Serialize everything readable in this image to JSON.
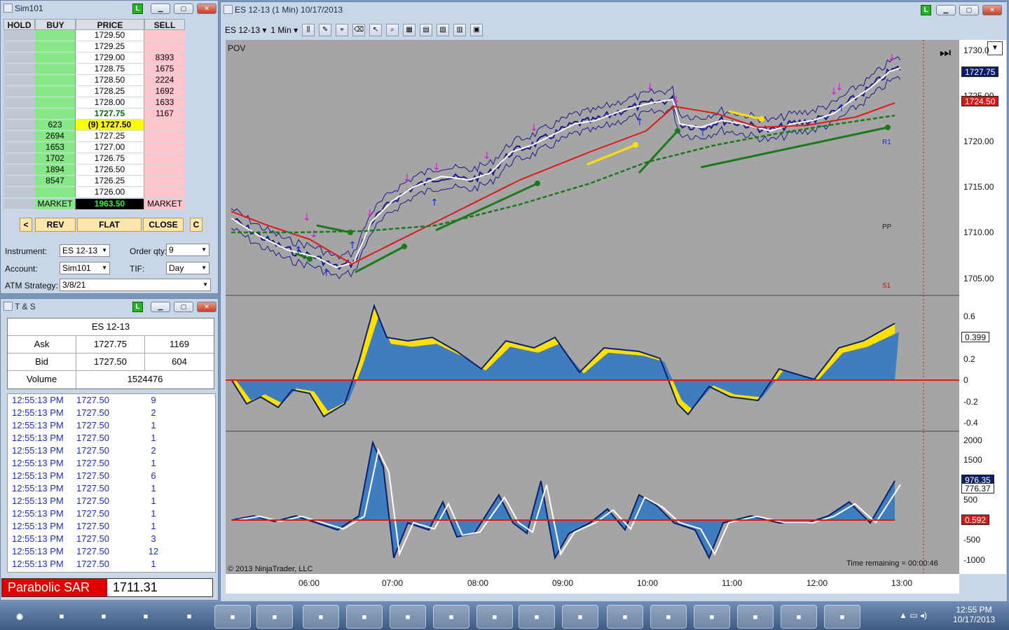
{
  "dom_window": {
    "title": "Sim101"
  },
  "dom": {
    "headers": [
      "HOLD",
      "BUY",
      "PRICE",
      "SELL"
    ],
    "rows": [
      {
        "buy": "",
        "price": "1729.50",
        "sell": ""
      },
      {
        "buy": "",
        "price": "1729.25",
        "sell": ""
      },
      {
        "buy": "",
        "price": "1729.00",
        "sell": "8393"
      },
      {
        "buy": "",
        "price": "1728.75",
        "sell": "1675"
      },
      {
        "buy": "",
        "price": "1728.50",
        "sell": "2224"
      },
      {
        "buy": "",
        "price": "1728.25",
        "sell": "1692"
      },
      {
        "buy": "",
        "price": "1728.00",
        "sell": "1633"
      },
      {
        "buy": "",
        "price": "1727.75",
        "sell": "1167"
      },
      {
        "buy": "623",
        "price": "(9) 1727.50",
        "sell": ""
      },
      {
        "buy": "2694",
        "price": "1727.25",
        "sell": ""
      },
      {
        "buy": "1653",
        "price": "1727.00",
        "sell": ""
      },
      {
        "buy": "1702",
        "price": "1726.75",
        "sell": ""
      },
      {
        "buy": "1894",
        "price": "1726.50",
        "sell": ""
      },
      {
        "buy": "8547",
        "price": "1726.25",
        "sell": ""
      },
      {
        "buy": "",
        "price": "1726.00",
        "sell": ""
      }
    ],
    "market_buy": "MARKET",
    "pnl": "1963.50",
    "market_sell": "MARKET"
  },
  "actions": {
    "left": "<",
    "rev": "REV",
    "flat": "FLAT",
    "close": "CLOSE",
    "c": "C"
  },
  "order": {
    "instrument_label": "Instrument:",
    "instrument": "ES 12-13",
    "qty_label": "Order qty:",
    "qty": "9",
    "account_label": "Account:",
    "account": "Sim101",
    "tif_label": "TIF:",
    "tif": "Day",
    "atm_label": "ATM Strategy:",
    "atm": "3/8/21"
  },
  "ts_window": {
    "title": "T & S",
    "instrument": "ES 12-13",
    "ask_label": "Ask",
    "ask": "1727.75",
    "ask_size": "1169",
    "bid_label": "Bid",
    "bid": "1727.50",
    "bid_size": "604",
    "volume_label": "Volume",
    "volume": "1524476",
    "trades": [
      {
        "t": "12:55:13 PM",
        "p": "1727.50",
        "q": "9"
      },
      {
        "t": "12:55:13 PM",
        "p": "1727.50",
        "q": "2"
      },
      {
        "t": "12:55:13 PM",
        "p": "1727.50",
        "q": "1"
      },
      {
        "t": "12:55:13 PM",
        "p": "1727.50",
        "q": "1"
      },
      {
        "t": "12:55:13 PM",
        "p": "1727.50",
        "q": "2"
      },
      {
        "t": "12:55:13 PM",
        "p": "1727.50",
        "q": "1"
      },
      {
        "t": "12:55:13 PM",
        "p": "1727.50",
        "q": "6"
      },
      {
        "t": "12:55:13 PM",
        "p": "1727.50",
        "q": "1"
      },
      {
        "t": "12:55:13 PM",
        "p": "1727.50",
        "q": "1"
      },
      {
        "t": "12:55:13 PM",
        "p": "1727.50",
        "q": "1"
      },
      {
        "t": "12:55:13 PM",
        "p": "1727.50",
        "q": "1"
      },
      {
        "t": "12:55:13 PM",
        "p": "1727.50",
        "q": "3"
      },
      {
        "t": "12:55:13 PM",
        "p": "1727.50",
        "q": "12"
      },
      {
        "t": "12:55:13 PM",
        "p": "1727.50",
        "q": "1"
      }
    ],
    "sar_label": "Parabolic SAR",
    "sar_value": "1711.31"
  },
  "chart_window": {
    "title": "ES 12-13 (1 Min)  10/17/2013",
    "instrument": "ES 12-13",
    "interval": "1 Min",
    "pov": "POV",
    "copyright": "© 2013 NinjaTrader, LLC",
    "time_remaining": "Time remaining = 00:00:46",
    "r1": "R1",
    "pp": "PP",
    "s1": "S1",
    "price_ticks": [
      "1730.0",
      "1725.00",
      "1720.00",
      "1715.00",
      "1710.00",
      "1705.00"
    ],
    "last_price": "1727.75",
    "ma_price": "1724.50",
    "osc1_ticks": [
      "0.6",
      "0.4",
      "0.2",
      "0",
      "-0.2",
      "-0.4"
    ],
    "osc1_value": "0.399",
    "osc2_ticks": [
      "2000",
      "1500",
      "1000",
      "500",
      "0",
      "-500",
      "-1000"
    ],
    "osc2_value_a": "976.35",
    "osc2_value_b": "776.37",
    "osc2_value_c": "0.592",
    "time_ticks": [
      "06:00",
      "07:00",
      "08:00",
      "09:00",
      "10:00",
      "11:00",
      "12:00",
      "13:00"
    ],
    "colors": {
      "price_line": "#1a1a8c",
      "ma_red": "#e01818",
      "ma_green": "#1a7a1a",
      "osc_fill": "#3f7dbf",
      "osc_yellow": "#ffe000",
      "zero": "#e01818"
    }
  },
  "taskbar": {
    "time": "12:55 PM",
    "date": "10/17/2013",
    "apps": [
      "start-orb",
      "internet-explorer",
      "game",
      "media-player",
      "live-messenger",
      "explorer",
      "ninjatrader",
      "settings",
      "notepad",
      "feeds",
      "forms",
      "outlook",
      "word",
      "excel",
      "powerpoint",
      "publisher",
      "spotify",
      "ie-2",
      "chrome",
      "camcorder"
    ]
  }
}
